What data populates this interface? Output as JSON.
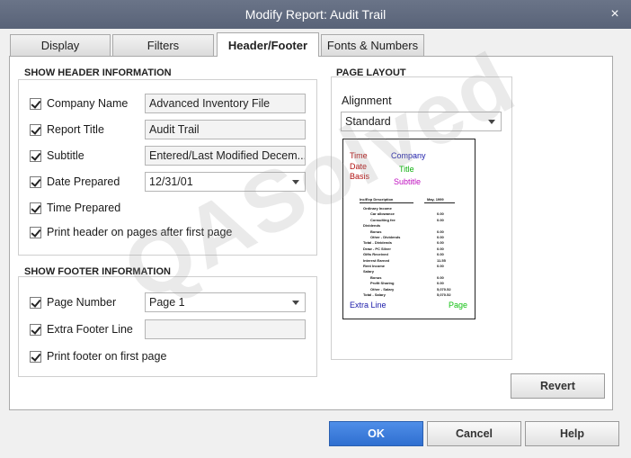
{
  "window": {
    "title": "Modify Report: Audit Trail",
    "close_label": "×"
  },
  "tabs": [
    {
      "label": "Display"
    },
    {
      "label": "Filters"
    },
    {
      "label": "Header/Footer"
    },
    {
      "label": "Fonts & Numbers"
    }
  ],
  "header_section": {
    "title": "SHOW HEADER INFORMATION",
    "company_name": {
      "label": "Company Name",
      "checked": true,
      "value": "Advanced Inventory File"
    },
    "report_title": {
      "label": "Report Title",
      "checked": true,
      "value": "Audit Trail"
    },
    "subtitle": {
      "label": "Subtitle",
      "checked": true,
      "value": "Entered/Last Modified Decem..."
    },
    "date_prepared": {
      "label": "Date Prepared",
      "checked": true,
      "value": "12/31/01"
    },
    "time_prepared": {
      "label": "Time Prepared",
      "checked": true
    },
    "print_header": {
      "label": "Print header on pages after first page",
      "checked": true
    }
  },
  "footer_section": {
    "title": "SHOW FOOTER INFORMATION",
    "page_number": {
      "label": "Page Number",
      "checked": true,
      "value": "Page 1"
    },
    "extra_footer": {
      "label": "Extra Footer Line",
      "checked": true,
      "value": ""
    },
    "print_footer": {
      "label": "Print footer on first page",
      "checked": true
    }
  },
  "page_layout": {
    "title": "PAGE LAYOUT",
    "alignment_label": "Alignment",
    "alignment_value": "Standard",
    "preview": {
      "time": "Time",
      "date": "Date",
      "basis": "Basis",
      "company": "Company",
      "title": "Title",
      "subtitle": "Subtitle",
      "extra_line": "Extra Line",
      "page": "Page",
      "colors": {
        "left": "#b01010",
        "company": "#1a1aa8",
        "title": "#10b010",
        "subtitle": "#c010c0",
        "extra": "#1a1aa8",
        "page": "#10c010"
      },
      "mini_header": [
        "Inc/Exp Description",
        "May, 1999"
      ],
      "mini_rows": [
        {
          "label": "Ordinary Income",
          "value": ""
        },
        {
          "label": "Car allowance",
          "value": "0.00"
        },
        {
          "label": "Consulting fee",
          "value": "0.00"
        },
        {
          "label": "Dividends",
          "value": ""
        },
        {
          "label": "Bonus",
          "value": "0.00"
        },
        {
          "label": "Other - Dividends",
          "value": "0.00"
        },
        {
          "label": "Total - Dividends",
          "value": "0.00"
        },
        {
          "label": "Draw - PC Silver",
          "value": "0.00"
        },
        {
          "label": "Gifts Received",
          "value": "0.00"
        },
        {
          "label": "Interest Earned",
          "value": "11.55"
        },
        {
          "label": "Rent Income",
          "value": "0.00"
        },
        {
          "label": "Salary",
          "value": ""
        },
        {
          "label": "Bonus",
          "value": "0.00"
        },
        {
          "label": "Profit Sharing",
          "value": "0.00"
        },
        {
          "label": "Other - Salary",
          "value": "5,070.52"
        },
        {
          "label": "Total - Salary",
          "value": "5,070.52"
        }
      ]
    }
  },
  "buttons": {
    "revert": "Revert",
    "ok": "OK",
    "cancel": "Cancel",
    "help": "Help"
  },
  "watermark": "QASolved"
}
